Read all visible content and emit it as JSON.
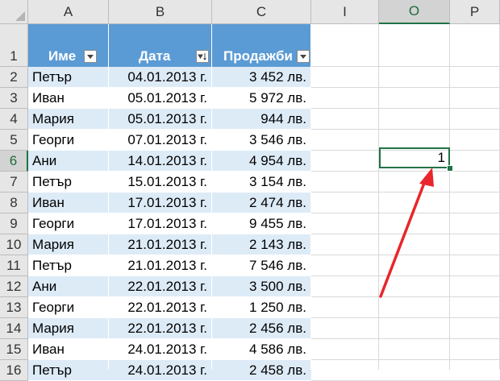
{
  "columns": [
    "A",
    "B",
    "C",
    "I",
    "O",
    "P"
  ],
  "active_column": "O",
  "rows": [
    "1",
    "2",
    "3",
    "4",
    "5",
    "6",
    "7",
    "8",
    "9",
    "10",
    "11",
    "12",
    "13",
    "14",
    "15",
    "16"
  ],
  "active_row": "6",
  "table": {
    "headers": [
      "Име",
      "Дата",
      "Продажби"
    ],
    "data": [
      [
        "Петър",
        "04.01.2013 г.",
        "3 452 лв."
      ],
      [
        "Иван",
        "05.01.2013 г.",
        "5 972 лв."
      ],
      [
        "Мария",
        "05.01.2013 г.",
        "944 лв."
      ],
      [
        "Георги",
        "07.01.2013 г.",
        "3 546 лв."
      ],
      [
        "Ани",
        "14.01.2013 г.",
        "4 954 лв."
      ],
      [
        "Петър",
        "15.01.2013 г.",
        "3 154 лв."
      ],
      [
        "Иван",
        "17.01.2013 г.",
        "2 474 лв."
      ],
      [
        "Георги",
        "17.01.2013 г.",
        "9 455 лв."
      ],
      [
        "Мария",
        "21.01.2013 г.",
        "2 143 лв."
      ],
      [
        "Петър",
        "21.01.2013 г.",
        "7 546 лв."
      ],
      [
        "Ани",
        "22.01.2013 г.",
        "3 500 лв."
      ],
      [
        "Георги",
        "22.01.2013 г.",
        "1 250 лв."
      ],
      [
        "Мария",
        "22.01.2013 г.",
        "2 456 лв."
      ],
      [
        "Иван",
        "24.01.2013 г.",
        "4 586 лв."
      ],
      [
        "Петър",
        "24.01.2013 г.",
        "2 458 лв."
      ]
    ]
  },
  "selected_cell": {
    "ref": "O6",
    "value": "1"
  },
  "colors": {
    "table_header": "#5b9bd5",
    "band_light": "#ddebf7",
    "band_white": "#ffffff",
    "selection": "#217346",
    "arrow": "#e8262b"
  },
  "icons": {
    "filter": "dropdown-filter-icon",
    "sort": "sort-ascending-filter-icon",
    "annotation": "red-arrow"
  }
}
